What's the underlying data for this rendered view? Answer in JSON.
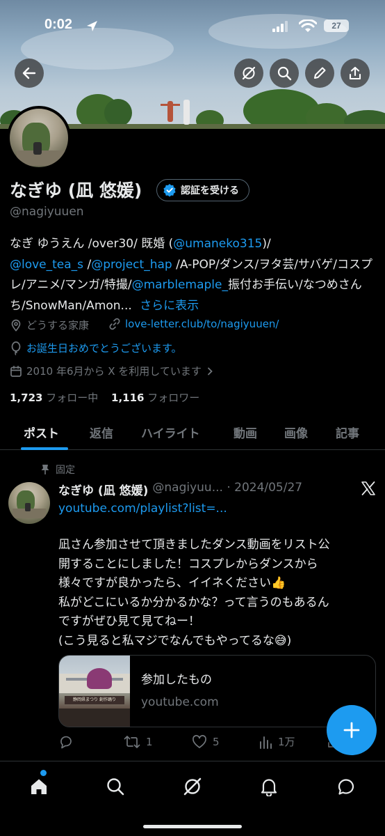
{
  "status": {
    "time": "0:02",
    "battery": "27"
  },
  "profile": {
    "name": "なぎゆ (凪 悠媛)",
    "verify_label": "認証を受ける",
    "handle": "@nagiyuuen",
    "bio": {
      "t1": "なぎ ゆうえん /over30/ 既婚 (",
      "m1": "@umaneko315",
      "t2": ")/",
      "m2": "@love_tea_s",
      "t3": " /",
      "m3": "@project_hap",
      "t4": " /A-POP/ダンス/ヲタ芸/サバゲ/コスプレ/アニメ/マンガ/特撮/",
      "m4": "@marblemaple_",
      "t5": "振付お手伝い/なつめさんち/SnowMan/Amon...",
      "more": "さらに表示"
    },
    "location": "どうする家康",
    "website": "love-letter.club/to/nagiyuuen/",
    "birthday": "お誕生日おめでとうございます。",
    "joined": "2010 年6月から X を利用しています",
    "following_count": "1,723",
    "following_label": "フォロー中",
    "followers_count": "1,116",
    "followers_label": "フォロワー"
  },
  "tabs": [
    "ポスト",
    "返信",
    "ハイライト",
    "動画",
    "画像",
    "記事"
  ],
  "post": {
    "pinned_label": "固定",
    "author": "なぎゆ (凪 悠媛)",
    "handle_date": "@nagiyuu... · 2024/05/27",
    "link": "youtube.com/playlist?list=...",
    "body_lines": [
      "凪さん参加させて頂きましたダンス動画をリスト公",
      "開することにしました！コスプレからダンスから",
      "様々ですが良かったら、イイネください👍",
      "私がどこにいるか分かるかな？って言うのもあるん",
      "ですがぜひ見て見てねー！",
      "(こう見ると私マジでなんでもやってるな😅)"
    ],
    "card": {
      "title": "参加したもの",
      "domain": "youtube.com",
      "thumb_banner": "静岡県まつり 創作踊り"
    },
    "replies": "",
    "reposts": "1",
    "likes": "5",
    "views": "1万"
  },
  "colors": {
    "accent": "#1d9bf0",
    "background": "#000000",
    "secondary_text": "#71767b"
  },
  "icons": {
    "back": "arrow-left-icon",
    "grok": "grok-icon",
    "search": "search-icon",
    "edit": "pencil-icon",
    "share": "share-icon",
    "verified": "verified-badge-icon",
    "location": "location-pin-icon",
    "link": "link-icon",
    "birthday": "balloon-icon",
    "calendar": "calendar-icon",
    "pin": "pin-icon",
    "x_logo": "x-logo-icon",
    "fab": "plus-icon",
    "nav": [
      "home-icon",
      "search-icon",
      "grok-icon",
      "bell-icon",
      "message-icon"
    ]
  }
}
